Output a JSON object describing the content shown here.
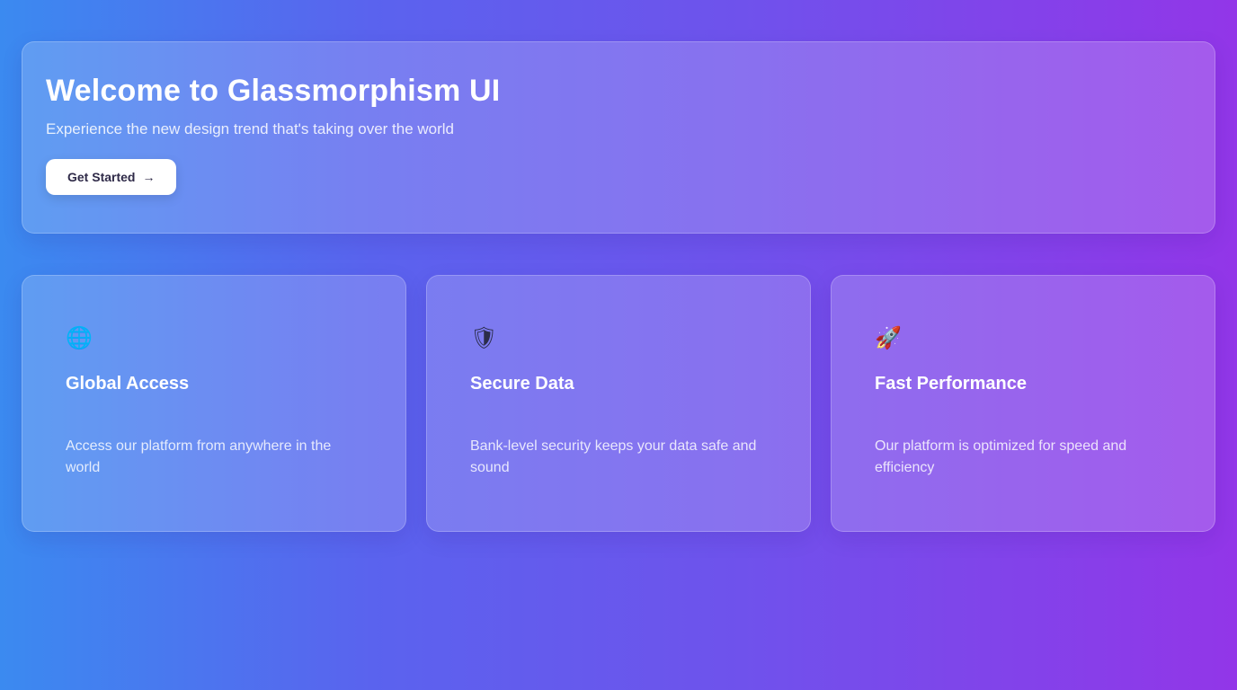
{
  "hero": {
    "title": "Welcome to Glassmorphism UI",
    "subtitle": "Experience the new design trend that's taking over the world",
    "cta_label": "Get Started",
    "cta_arrow": "→"
  },
  "cards": [
    {
      "icon": "globe-icon",
      "icon_glyph": "🌐",
      "title": "Global Access",
      "description": "Access our platform from anywhere in the world"
    },
    {
      "icon": "shield-icon",
      "icon_glyph": "🛡",
      "title": "Secure Data",
      "description": "Bank-level security keeps your data safe and sound"
    },
    {
      "icon": "rocket-icon",
      "icon_glyph": "🚀",
      "title": "Fast Performance",
      "description": "Our platform is optimized for speed and efficiency"
    }
  ],
  "colors": {
    "gradient_start": "#3b8af0",
    "gradient_end": "#9236e8",
    "button_bg": "#ffffff",
    "button_text": "#2f2a48"
  }
}
